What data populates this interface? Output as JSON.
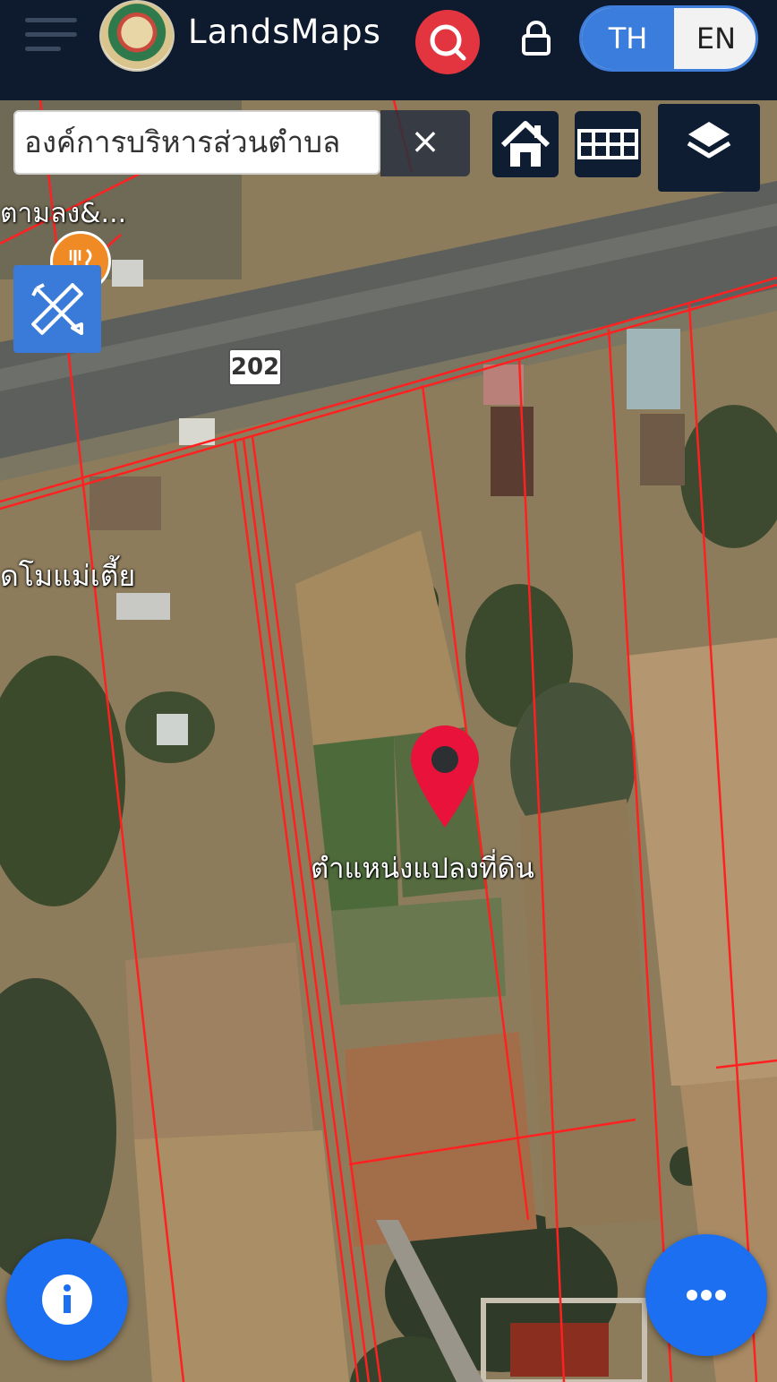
{
  "header": {
    "app_title": "LandsMaps",
    "languages": {
      "th": "TH",
      "en": "EN",
      "selected": "TH"
    }
  },
  "search": {
    "value": "องค์การบริหารส่วนตำบล",
    "clear_label": "×"
  },
  "map": {
    "road_number": "202",
    "labels": {
      "top_left_place": "ตามลง&...",
      "left_place": "ดโมแม่เตี้ย",
      "pin_label": "ตำแหน่งแปลงที่ดิน"
    }
  },
  "colors": {
    "header_bg": "#0e1a2e",
    "accent_blue": "#1c6ff0",
    "search_red": "#e2353f",
    "parcel_lines": "#ff2020",
    "pin_red": "#e8123a"
  }
}
